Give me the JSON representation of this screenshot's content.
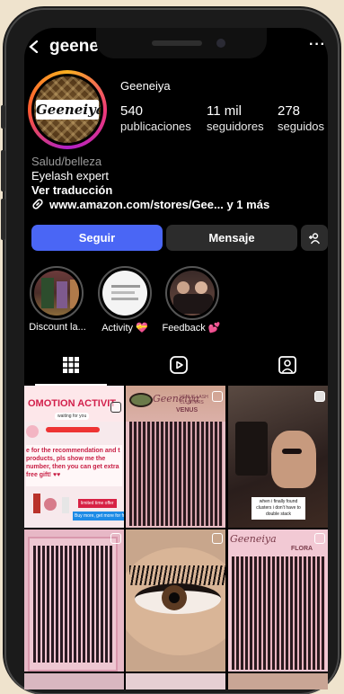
{
  "profile": {
    "username": "geene",
    "display_name": "Geeneiya",
    "avatar_logo_text": "Geeneiya",
    "more_label": "···"
  },
  "stats": [
    {
      "value": "540",
      "label": "publicaciones"
    },
    {
      "value": "11 mil",
      "label": "seguidores"
    },
    {
      "value": "278",
      "label": "seguidos"
    }
  ],
  "bio": {
    "category": "Salud/belleza",
    "line1": "Eyelash expert",
    "translate": "Ver traducción",
    "link": "www.amazon.com/stores/Gee... y 1 más"
  },
  "actions": {
    "follow": "Seguir",
    "message": "Mensaje",
    "add_user_icon": "person-plus-icon"
  },
  "highlights": [
    {
      "label": "Discount la..."
    },
    {
      "label": "Activity 💝"
    },
    {
      "label": "Feedback 💕"
    }
  ],
  "tabs": [
    "grid-icon",
    "reels-icon",
    "tagged-icon"
  ],
  "posts": {
    "post1": {
      "title": "OMOTION ACTIVIT",
      "sub": "waiting for you",
      "text": "e for the recommendation and t products, pls show me the number, then you can get extra free gift! ♥♥",
      "banner1": "limited time offer",
      "banner2": "Buy more, get more for free"
    },
    "post2": {
      "brand": "Geeneiya",
      "series": "VENUS LASH CLUSTERS",
      "name": "VENUS"
    },
    "post3": {
      "caption": "when i finally found clusters i don't have to double stack"
    },
    "post5": {
      "brand": "Geeneiya",
      "name": "FLORA"
    }
  },
  "colors": {
    "accent": "#4a66f5",
    "background": "#000000",
    "button_secondary": "#2c2c2c",
    "frame_bg": "#efe3cd"
  }
}
